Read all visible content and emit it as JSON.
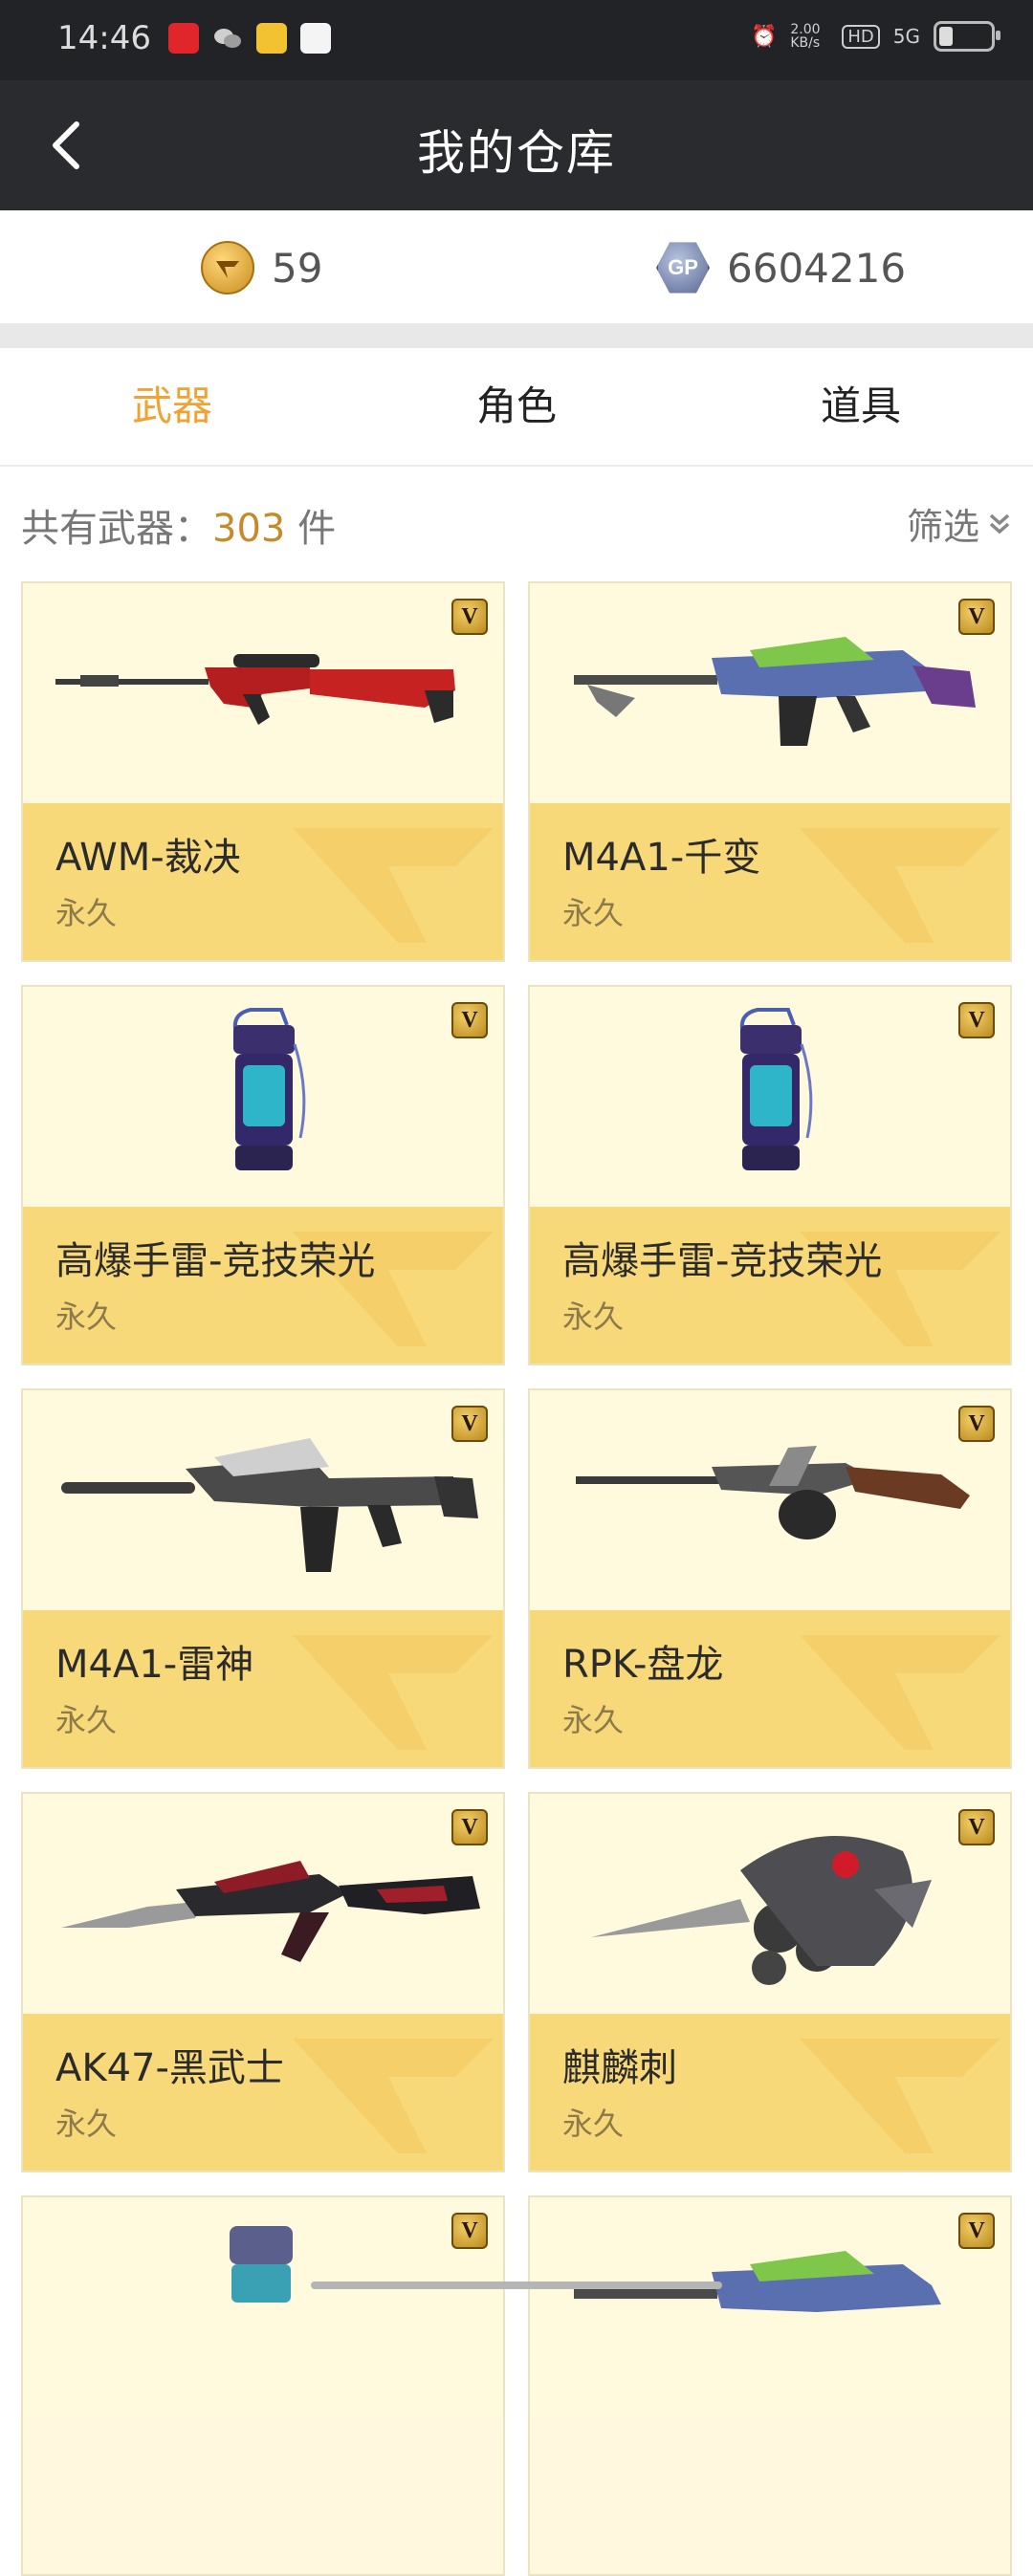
{
  "status_bar": {
    "time": "14:46",
    "net_speed": "2.00\nKB/s",
    "hd": "HD",
    "signal": "5G"
  },
  "header": {
    "title": "我的仓库"
  },
  "balances": {
    "cf_points": "59",
    "gp_points": "6604216",
    "gp_badge": "GP"
  },
  "tabs": [
    {
      "label": "武器",
      "active": true
    },
    {
      "label": "角色",
      "active": false
    },
    {
      "label": "道具",
      "active": false
    }
  ],
  "count": {
    "prefix": "共有武器：",
    "number": "303",
    "suffix": " 件"
  },
  "filter_label": "筛选",
  "items": [
    {
      "name": "AWM-裁决",
      "duration": "永久",
      "badge": "V",
      "icon": "sniper-rifle-icon"
    },
    {
      "name": "M4A1-千变",
      "duration": "永久",
      "badge": "V",
      "icon": "assault-rifle-icon"
    },
    {
      "name": "高爆手雷-竞技荣光",
      "duration": "永久",
      "badge": "V",
      "icon": "grenade-icon"
    },
    {
      "name": "高爆手雷-竞技荣光",
      "duration": "永久",
      "badge": "V",
      "icon": "grenade-icon"
    },
    {
      "name": "M4A1-雷神",
      "duration": "永久",
      "badge": "V",
      "icon": "assault-rifle-icon"
    },
    {
      "name": "RPK-盘龙",
      "duration": "永久",
      "badge": "V",
      "icon": "machine-gun-icon"
    },
    {
      "name": "AK47-黑武士",
      "duration": "永久",
      "badge": "V",
      "icon": "assault-rifle-icon"
    },
    {
      "name": "麒麟刺",
      "duration": "永久",
      "badge": "V",
      "icon": "knuckle-blade-icon"
    },
    {
      "name": "",
      "duration": "",
      "badge": "V",
      "icon": "grenade-icon"
    },
    {
      "name": "",
      "duration": "",
      "badge": "V",
      "icon": "assault-rifle-icon"
    }
  ],
  "colors": {
    "accent": "#f0a232",
    "header_bg": "#2a2b2f",
    "card_bottom": "#f8d97a",
    "card_top": "#fff9de"
  }
}
